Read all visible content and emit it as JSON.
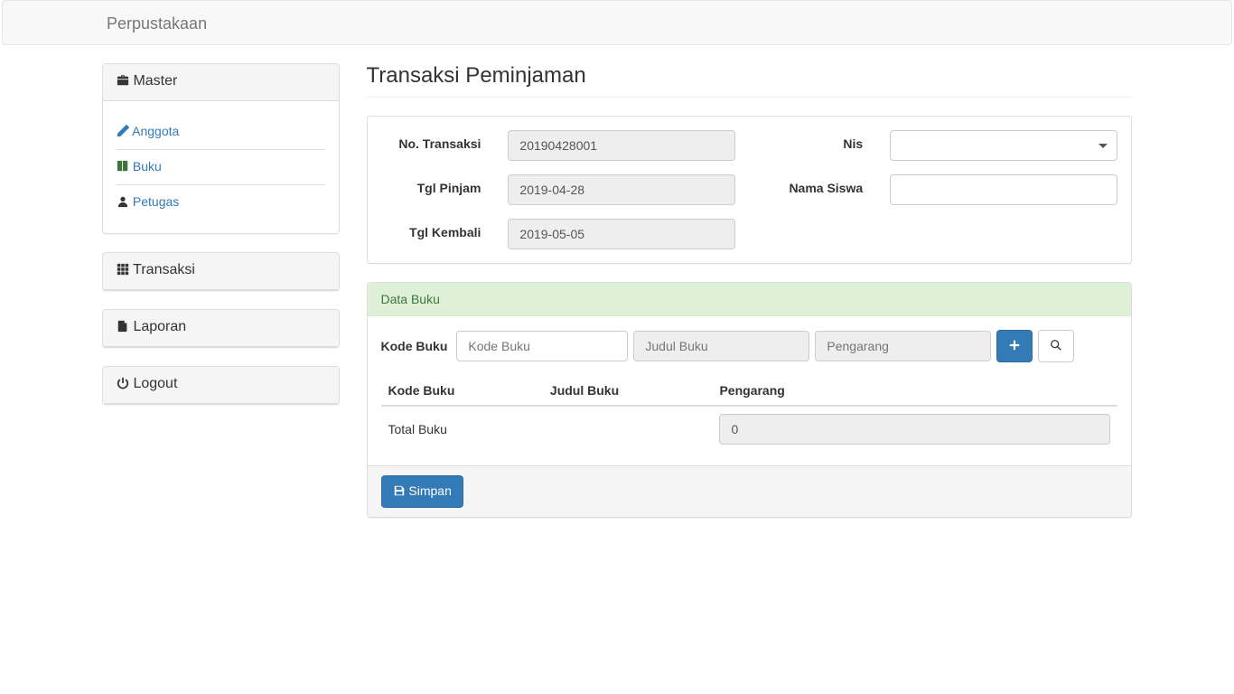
{
  "navbar": {
    "brand": "Perpustakaan"
  },
  "sidebar": {
    "master": {
      "title": "Master",
      "items": [
        {
          "label": "Anggota"
        },
        {
          "label": "Buku"
        },
        {
          "label": "Petugas"
        }
      ]
    },
    "transaksi": {
      "title": "Transaksi"
    },
    "laporan": {
      "title": "Laporan"
    },
    "logout": {
      "title": "Logout"
    }
  },
  "page": {
    "header": "Transaksi Peminjaman"
  },
  "form": {
    "no_transaksi_label": "No. Transaksi",
    "no_transaksi_value": "20190428001",
    "tgl_pinjam_label": "Tgl Pinjam",
    "tgl_pinjam_value": "2019-04-28",
    "tgl_kembali_label": "Tgl Kembali",
    "tgl_kembali_value": "2019-05-05",
    "nis_label": "Nis",
    "nis_value": "",
    "nama_siswa_label": "Nama Siswa",
    "nama_siswa_value": ""
  },
  "data_buku": {
    "panel_title": "Data Buku",
    "kode_label": "Kode Buku",
    "kode_placeholder": "Kode Buku",
    "judul_placeholder": "Judul Buku",
    "pengarang_placeholder": "Pengarang",
    "table_headers": {
      "kode": "Kode Buku",
      "judul": "Judul Buku",
      "pengarang": "Pengarang"
    },
    "total_label": "Total Buku",
    "total_value": "0",
    "simpan_label": "Simpan"
  }
}
